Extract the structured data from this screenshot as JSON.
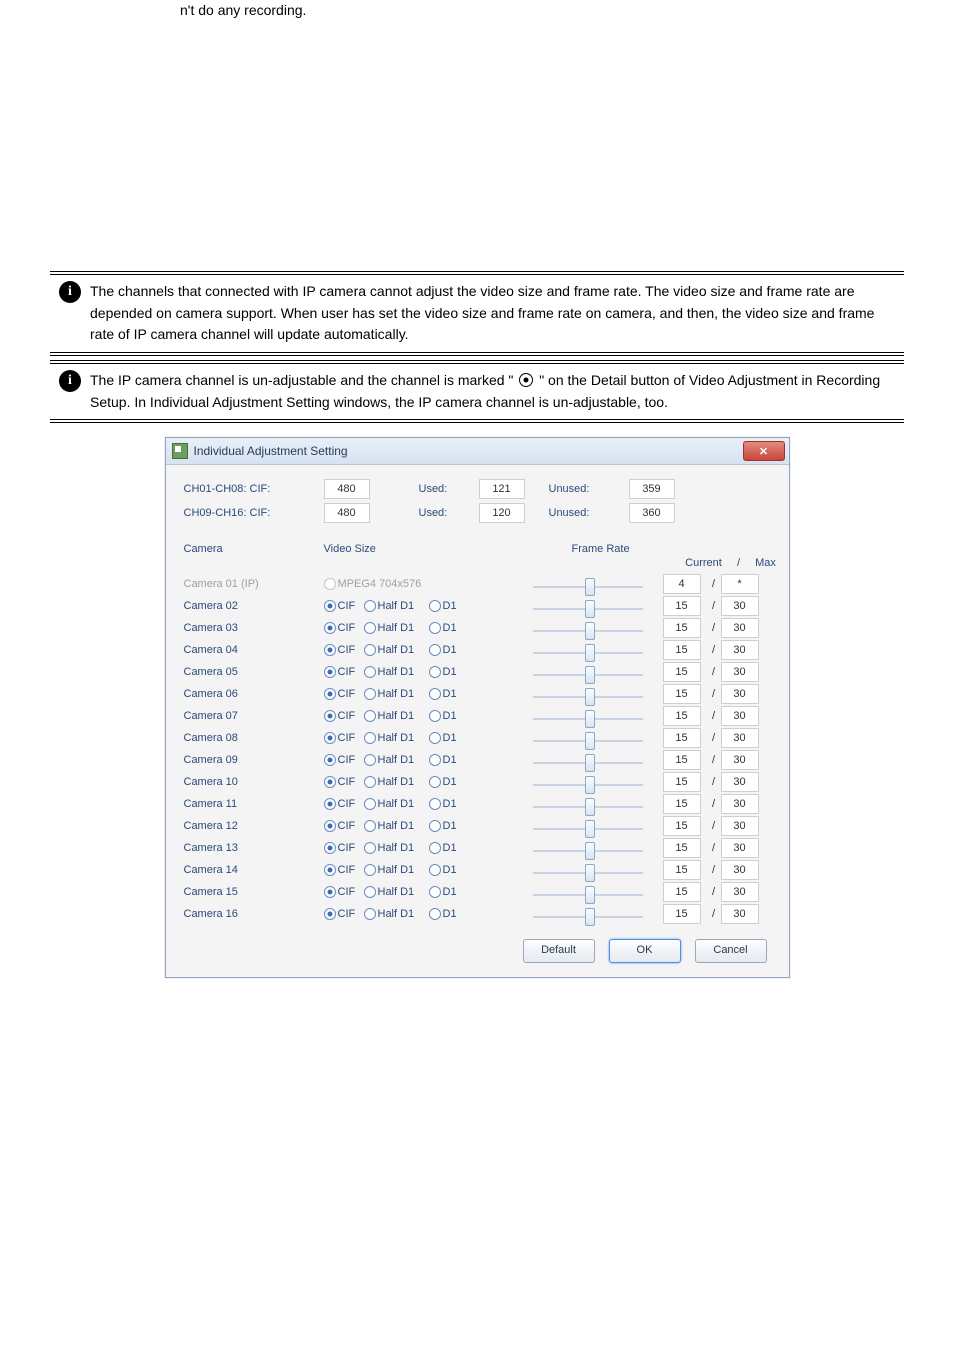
{
  "doc": {
    "snippet1": "n't do any recording.",
    "info1_text": "The channels that connected with IP camera cannot adjust the video size and frame rate. The video size and frame rate are depended on camera support. When user has set the video size and frame rate on camera, and then, the video size and frame rate of IP camera channel will update automatically.",
    "info2_pre": "The IP camera channel is un-adjustable and the channel is marked  \" ",
    "info2_mid": " \" on the Detail button of Video Adjustment in Recording Setup. In Individual Adjustment Setting windows, the IP camera channel is un-adjustable, too."
  },
  "dialog": {
    "title": "Individual Adjustment Setting",
    "summary_rows": [
      {
        "label": "CH01-CH08: CIF:",
        "total": "480",
        "used_label": "Used:",
        "used": "121",
        "unused_label": "Unused:",
        "unused": "359"
      },
      {
        "label": "CH09-CH16: CIF:",
        "total": "480",
        "used_label": "Used:",
        "used": "120",
        "unused_label": "Unused:",
        "unused": "360"
      }
    ],
    "headers": {
      "camera": "Camera",
      "videosize": "Video Size",
      "framerate": "Frame Rate",
      "current": "Current",
      "slash": "/",
      "max": "Max"
    },
    "size_labels": {
      "cif": "CIF",
      "half": "Half D1",
      "d1": "D1",
      "mpeg": "MPEG4  704x576"
    },
    "rows": [
      {
        "name": "Camera 01 (IP)",
        "disabled": true,
        "mpeg": true,
        "slider": 0.48,
        "current": "4",
        "max": "*"
      },
      {
        "name": "Camera 02",
        "cur": "15",
        "max": "30",
        "slider": 0.48
      },
      {
        "name": "Camera 03",
        "cur": "15",
        "max": "30",
        "slider": 0.48
      },
      {
        "name": "Camera 04",
        "cur": "15",
        "max": "30",
        "slider": 0.48
      },
      {
        "name": "Camera 05",
        "cur": "15",
        "max": "30",
        "slider": 0.48
      },
      {
        "name": "Camera 06",
        "cur": "15",
        "max": "30",
        "slider": 0.48
      },
      {
        "name": "Camera 07",
        "cur": "15",
        "max": "30",
        "slider": 0.48
      },
      {
        "name": "Camera 08",
        "cur": "15",
        "max": "30",
        "slider": 0.48
      },
      {
        "name": "Camera 09",
        "cur": "15",
        "max": "30",
        "slider": 0.48
      },
      {
        "name": "Camera 10",
        "cur": "15",
        "max": "30",
        "slider": 0.48
      },
      {
        "name": "Camera 11",
        "cur": "15",
        "max": "30",
        "slider": 0.48
      },
      {
        "name": "Camera 12",
        "cur": "15",
        "max": "30",
        "slider": 0.48
      },
      {
        "name": "Camera 13",
        "cur": "15",
        "max": "30",
        "slider": 0.48
      },
      {
        "name": "Camera 14",
        "cur": "15",
        "max": "30",
        "slider": 0.48
      },
      {
        "name": "Camera 15",
        "cur": "15",
        "max": "30",
        "slider": 0.48
      },
      {
        "name": "Camera 16",
        "cur": "15",
        "max": "30",
        "slider": 0.48
      }
    ],
    "buttons": {
      "default": "Default",
      "ok": "OK",
      "cancel": "Cancel"
    }
  }
}
